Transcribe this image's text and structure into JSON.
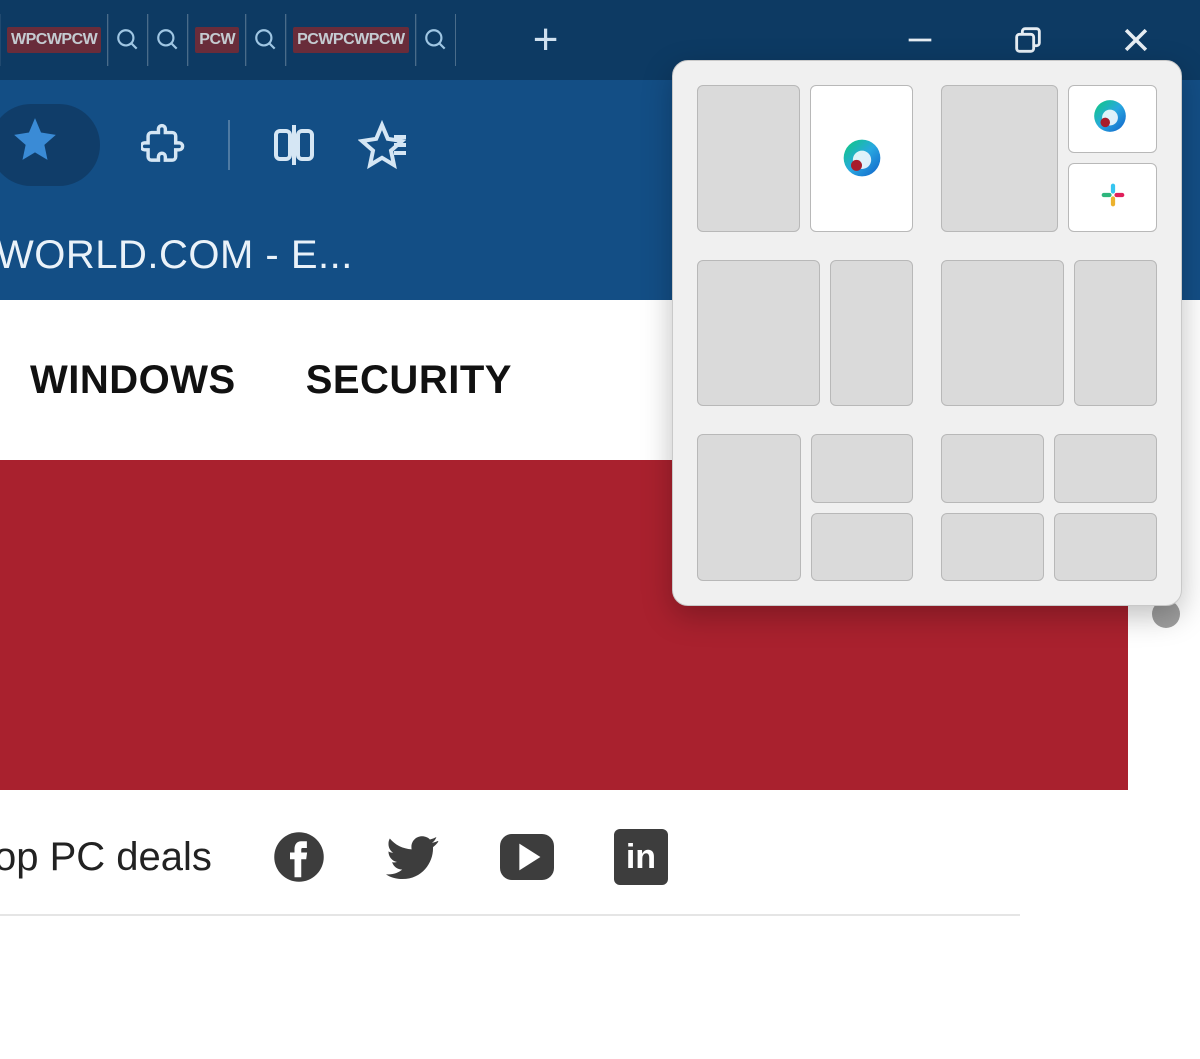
{
  "window": {
    "new_tab_glyph": "+",
    "tabs": [
      {
        "favicon_text": "WPCWPCW"
      },
      {
        "favicon": "search"
      },
      {
        "favicon": "search"
      },
      {
        "favicon_text": "PCW"
      },
      {
        "favicon": "search"
      },
      {
        "favicon_text": "PCWPCWPCW"
      },
      {
        "favicon": "search"
      }
    ]
  },
  "toolbar": {
    "page_title": "WORLD.COM - E..."
  },
  "page": {
    "nav": {
      "item1": "WINDOWS",
      "item2": "SECURITY"
    },
    "deals_label": "op PC deals",
    "linkedin_text": "in"
  },
  "snap_layouts": {
    "icons": {
      "edge": "Microsoft Edge",
      "slack": "Slack"
    }
  }
}
